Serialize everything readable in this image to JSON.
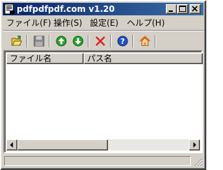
{
  "window": {
    "title": "pdfpdfpdf.com v1.20"
  },
  "menu": {
    "items": [
      {
        "label": "ファイル(F)"
      },
      {
        "label": "操作(S)"
      },
      {
        "label": "設定(E)"
      },
      {
        "label": "ヘルプ(H)"
      }
    ]
  },
  "toolbar": {
    "buttons": [
      {
        "icon": "open-folder-icon"
      },
      {
        "icon": "save-disk-icon"
      },
      {
        "icon": "arrow-up-icon"
      },
      {
        "icon": "arrow-down-icon"
      },
      {
        "icon": "delete-x-icon"
      },
      {
        "icon": "help-icon"
      },
      {
        "icon": "home-icon"
      }
    ]
  },
  "list": {
    "columns": [
      {
        "label": "ファイル名"
      },
      {
        "label": "パス名"
      }
    ],
    "rows": []
  },
  "colors": {
    "titlebar_start": "#0a246a",
    "titlebar_end": "#3a6ea5",
    "face": "#d4d0c8"
  }
}
